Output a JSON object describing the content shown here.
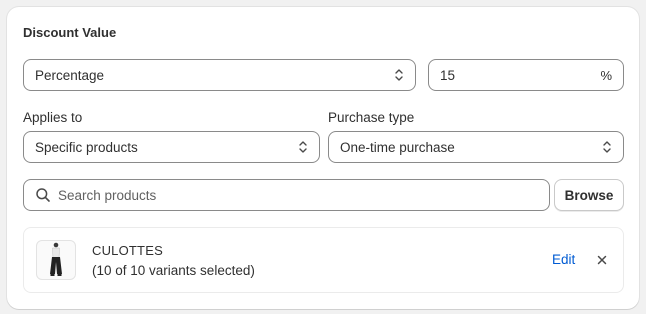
{
  "section": {
    "title": "Discount Value"
  },
  "discount": {
    "type_value": "Percentage",
    "amount_value": "15",
    "amount_suffix": "%"
  },
  "applies_to": {
    "label": "Applies to",
    "value": "Specific products"
  },
  "purchase_type": {
    "label": "Purchase type",
    "value": "One-time purchase"
  },
  "search": {
    "placeholder": "Search products",
    "browse_label": "Browse"
  },
  "products": [
    {
      "name": "CULOTTES",
      "variants": "(10 of 10 variants selected)",
      "edit_label": "Edit"
    }
  ],
  "colors": {
    "link": "#005bd3",
    "border": "#8a8a8a",
    "background": "#f1f1f1"
  }
}
